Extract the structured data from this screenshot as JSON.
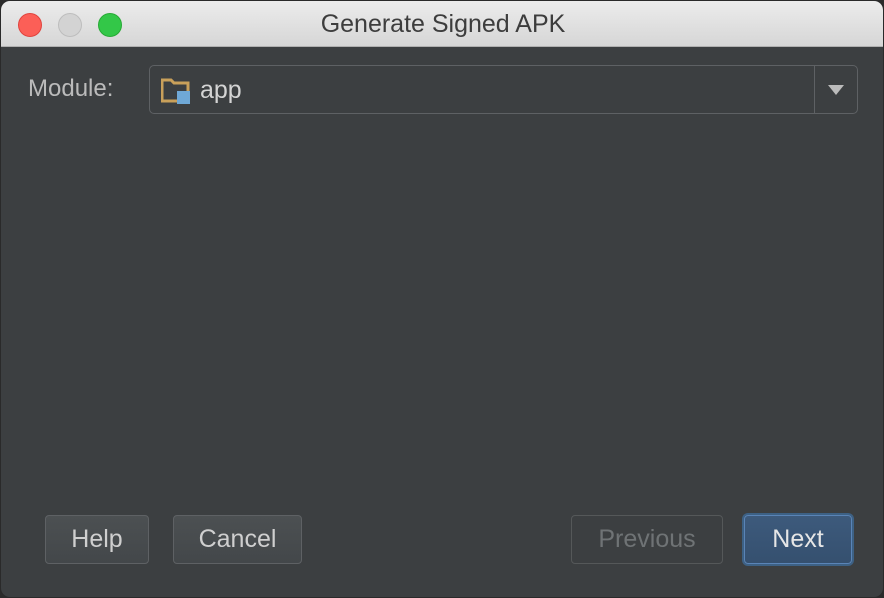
{
  "window": {
    "title": "Generate Signed APK"
  },
  "module": {
    "label": "Module:",
    "selected": "app",
    "icon": "module-folder-icon"
  },
  "buttons": {
    "help": "Help",
    "cancel": "Cancel",
    "previous": "Previous",
    "next": "Next"
  },
  "colors": {
    "background": "#3c3f41",
    "accent": "#3d6185",
    "close": "#fc5f57",
    "zoom": "#33c748"
  }
}
